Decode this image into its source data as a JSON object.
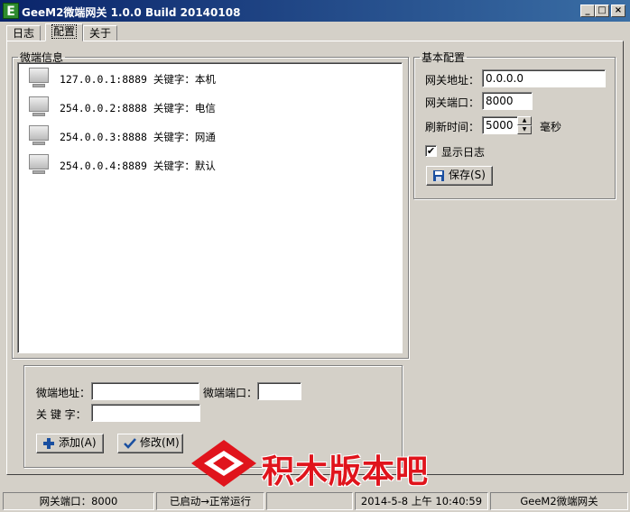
{
  "window": {
    "title": "GeeM2微端网关 1.0.0 Build 20140108",
    "icon_letter": "E",
    "minimize": "_",
    "maximize": "□",
    "close": "×"
  },
  "tabs": [
    {
      "label": "日志"
    },
    {
      "label": "配置"
    },
    {
      "label": "关于"
    }
  ],
  "microclient_info": {
    "legend": "微端信息",
    "items": [
      {
        "text": "127.0.0.1:8889 关键字：本机"
      },
      {
        "text": "254.0.0.2:8888 关键字：电信"
      },
      {
        "text": "254.0.0.3:8888 关键字：网通"
      },
      {
        "text": "254.0.0.4:8889 关键字：默认"
      }
    ]
  },
  "edit_area": {
    "address_label": "微端地址：",
    "address_value": "",
    "port_label": "微端端口：",
    "port_value": "",
    "keyword_label": "关 键 字：",
    "keyword_value": "",
    "add_button": "添加(A)",
    "modify_button": "修改(M)"
  },
  "basic_config": {
    "legend": "基本配置",
    "gateway_address_label": "网关地址：",
    "gateway_address_value": "0.0.0.0",
    "gateway_port_label": "网关端口：",
    "gateway_port_value": "8000",
    "refresh_label": "刷新时间：",
    "refresh_value": "5000",
    "refresh_unit": "毫秒",
    "show_log_label": "显示日志",
    "show_log_checked": true,
    "save_button": "保存(S)"
  },
  "statusbar": {
    "port": "网关端口：8000",
    "state": "已启动→正常运行",
    "empty": "",
    "datetime": "2014-5-8 上午 10:40:59",
    "app": "GeeM2微端网关"
  },
  "watermark": {
    "text": "积木版本吧"
  },
  "colors": {
    "title_start": "#0a246a",
    "title_end": "#3a6ea5",
    "face": "#d4d0c8",
    "watermark_red": "#e0141c"
  }
}
